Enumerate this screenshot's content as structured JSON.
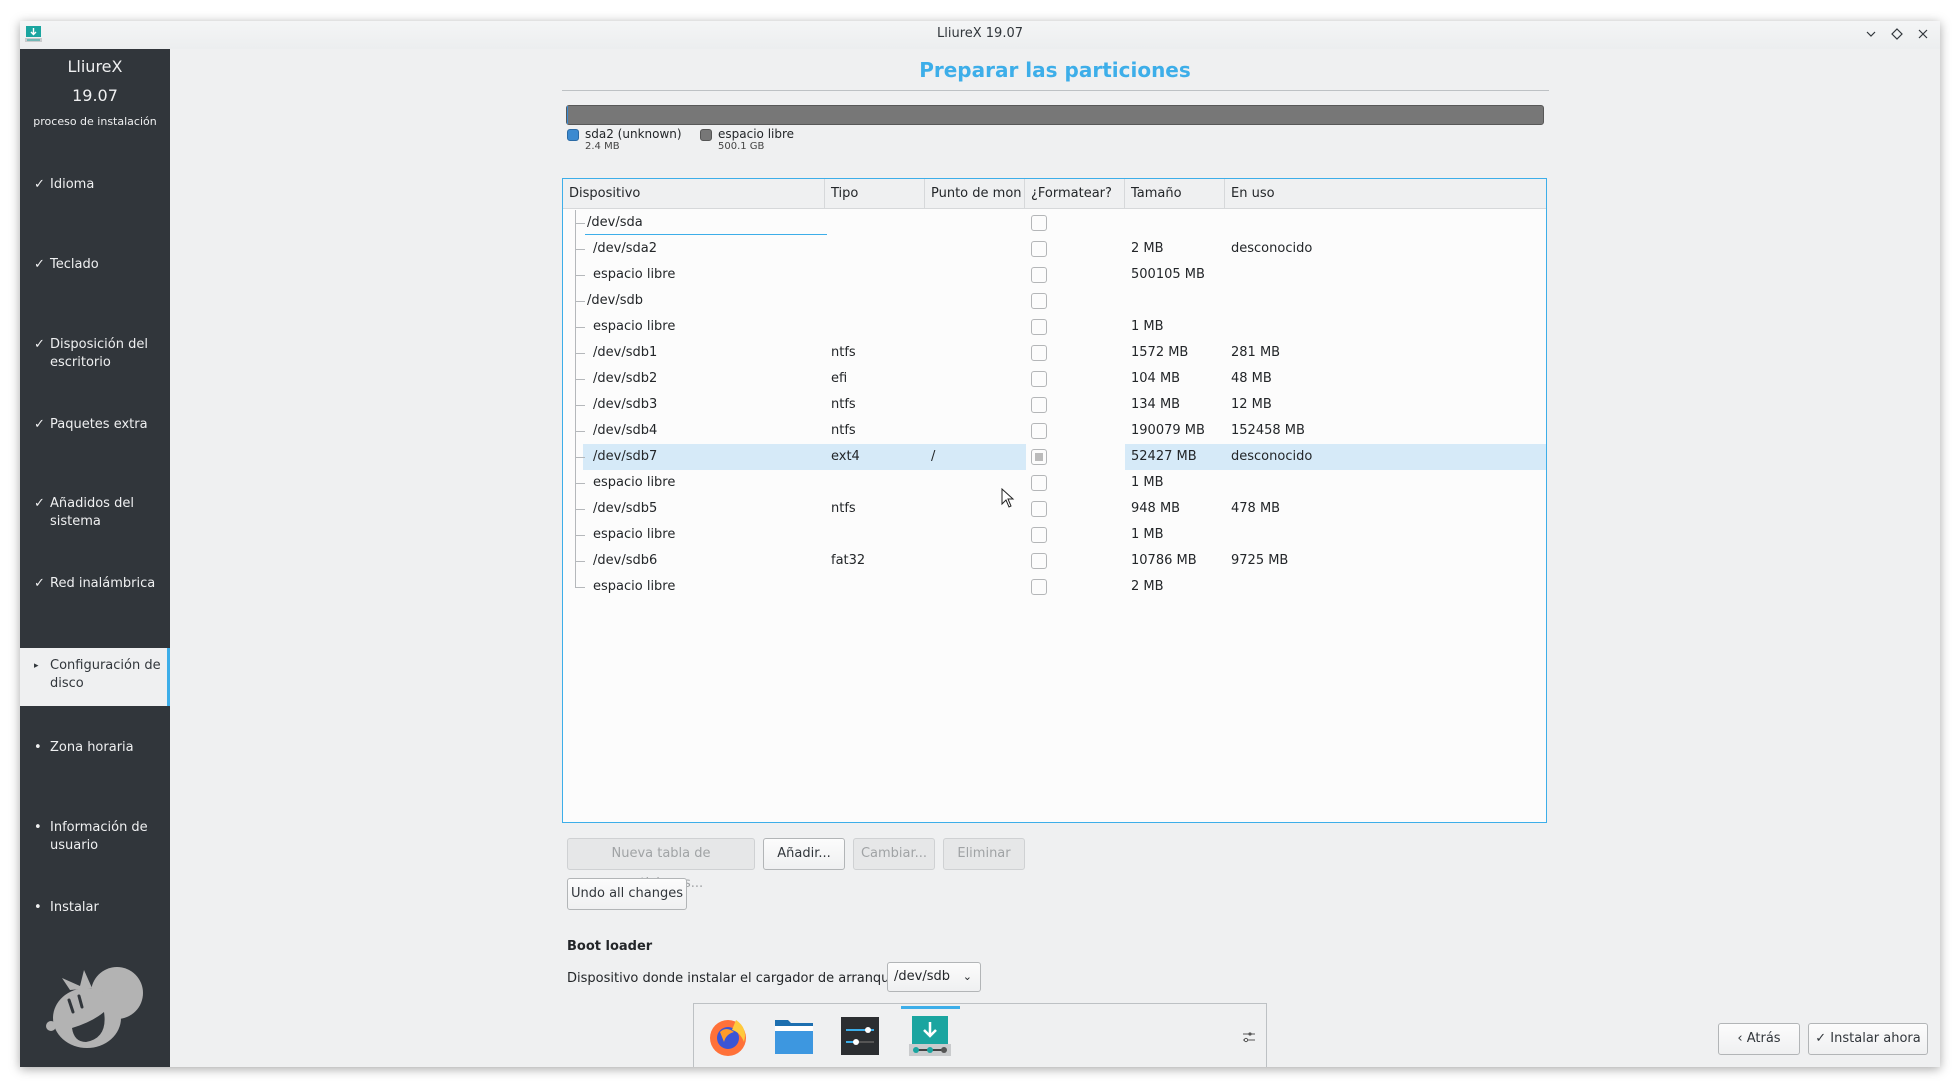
{
  "window": {
    "title": "LliureX 19.07",
    "controls": [
      "minimize",
      "maximize",
      "close"
    ]
  },
  "sidebar": {
    "brand": "LliureX",
    "version": "19.07",
    "subtitle": "proceso de instalación",
    "items": [
      {
        "label": "Idioma",
        "state": "done",
        "mark": "✓"
      },
      {
        "label": "Teclado",
        "state": "done",
        "mark": "✓"
      },
      {
        "label": "Disposición del escritorio",
        "state": "done",
        "mark": "✓"
      },
      {
        "label": "Paquetes extra",
        "state": "done",
        "mark": "✓"
      },
      {
        "label": "Añadidos del sistema",
        "state": "done",
        "mark": "✓"
      },
      {
        "label": "Red inalámbrica",
        "state": "done",
        "mark": "✓"
      },
      {
        "label": "Configuración de disco",
        "state": "current",
        "mark": "▸"
      },
      {
        "label": "Zona horaria",
        "state": "pending",
        "mark": "•"
      },
      {
        "label": "Información de usuario",
        "state": "pending",
        "mark": "•"
      },
      {
        "label": "Instalar",
        "state": "pending",
        "mark": "•"
      }
    ]
  },
  "main": {
    "title": "Preparar las particiones",
    "disk_bar": {
      "segments": [
        {
          "label": "sda2 (unknown)",
          "size": "2.4 MB",
          "color": "#3c8ad0"
        },
        {
          "label": "espacio libre",
          "size": "500.1 GB",
          "color": "#777777"
        }
      ]
    },
    "table": {
      "columns": [
        "Dispositivo",
        "Tipo",
        "Punto de montaje",
        "¿Formatear?",
        "Tamaño",
        "En uso"
      ],
      "column_header_visible": [
        "Dispositivo",
        "Tipo",
        "Punto de mon",
        "¿Formatear?",
        "Tamaño",
        "En uso"
      ],
      "rows": [
        {
          "device": "/dev/sda",
          "type": "",
          "mount": "",
          "format": false,
          "size": "",
          "used": "",
          "level": 0
        },
        {
          "device": "/dev/sda2",
          "type": "",
          "mount": "",
          "format": false,
          "size": "2 MB",
          "used": "desconocido",
          "level": 1
        },
        {
          "device": "espacio libre",
          "type": "",
          "mount": "",
          "format": false,
          "size": "500105 MB",
          "used": "",
          "level": 1
        },
        {
          "device": "/dev/sdb",
          "type": "",
          "mount": "",
          "format": false,
          "size": "",
          "used": "",
          "level": 0
        },
        {
          "device": "espacio libre",
          "type": "",
          "mount": "",
          "format": false,
          "size": "1 MB",
          "used": "",
          "level": 1
        },
        {
          "device": "/dev/sdb1",
          "type": "ntfs",
          "mount": "",
          "format": false,
          "size": "1572 MB",
          "used": "281 MB",
          "level": 1
        },
        {
          "device": "/dev/sdb2",
          "type": "efi",
          "mount": "",
          "format": false,
          "size": "104 MB",
          "used": "48 MB",
          "level": 1
        },
        {
          "device": "/dev/sdb3",
          "type": "ntfs",
          "mount": "",
          "format": false,
          "size": "134 MB",
          "used": "12 MB",
          "level": 1
        },
        {
          "device": "/dev/sdb4",
          "type": "ntfs",
          "mount": "",
          "format": false,
          "size": "190079 MB",
          "used": "152458 MB",
          "level": 1
        },
        {
          "device": "/dev/sdb7",
          "type": "ext4",
          "mount": "/",
          "format": "partial",
          "size": "52427 MB",
          "used": "desconocido",
          "level": 1,
          "selected": true
        },
        {
          "device": "espacio libre",
          "type": "",
          "mount": "",
          "format": false,
          "size": "1 MB",
          "used": "",
          "level": 1
        },
        {
          "device": "/dev/sdb5",
          "type": "ntfs",
          "mount": "",
          "format": false,
          "size": "948 MB",
          "used": "478 MB",
          "level": 1
        },
        {
          "device": "espacio libre",
          "type": "",
          "mount": "",
          "format": false,
          "size": "1 MB",
          "used": "",
          "level": 1
        },
        {
          "device": "/dev/sdb6",
          "type": "fat32",
          "mount": "",
          "format": false,
          "size": "10786 MB",
          "used": "9725 MB",
          "level": 1
        },
        {
          "device": "espacio libre",
          "type": "",
          "mount": "",
          "format": false,
          "size": "2 MB",
          "used": "",
          "level": 1
        }
      ]
    },
    "buttons": {
      "new_table": "Nueva tabla de particiones...",
      "add": "Añadir...",
      "change": "Cambiar...",
      "delete": "Eliminar",
      "undo": "Undo all changes"
    },
    "bootloader": {
      "title": "Boot loader",
      "label": "Dispositivo donde instalar el cargador de arranque:",
      "selected": "/dev/sdb"
    }
  },
  "footer": {
    "back": "Atrás",
    "install": "Instalar ahora"
  },
  "taskbar": {
    "apps": [
      "firefox",
      "file-manager",
      "system-settings",
      "installer"
    ],
    "active_app": "installer"
  },
  "colors": {
    "accent": "#3daee9",
    "sidebar_bg": "#31363b",
    "selection": "#d6eaf8"
  }
}
